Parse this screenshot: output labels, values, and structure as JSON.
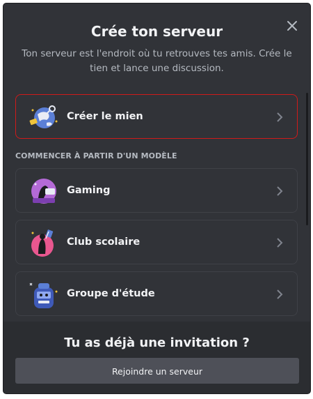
{
  "modal": {
    "title": "Crée ton serveur",
    "subtitle": "Ton serveur est l'endroit où tu retrouves tes amis. Crée le tien et lance une discussion.",
    "close_icon": "close-icon",
    "primary_option": {
      "label": "Créer le mien",
      "icon": "globe-icon"
    },
    "section_label": "COMMENCER À PARTIR D'UN MODÈLE",
    "templates": [
      {
        "label": "Gaming",
        "icon": "gaming-icon"
      },
      {
        "label": "Club scolaire",
        "icon": "school-club-icon"
      },
      {
        "label": "Groupe d'étude",
        "icon": "study-group-icon"
      }
    ]
  },
  "footer": {
    "title": "Tu as déjà une invitation ?",
    "join_label": "Rejoindre un serveur"
  },
  "colors": {
    "background": "#313338",
    "footer_background": "#2b2d31",
    "selected_border": "#d01a1a",
    "button": "#4e5058"
  }
}
